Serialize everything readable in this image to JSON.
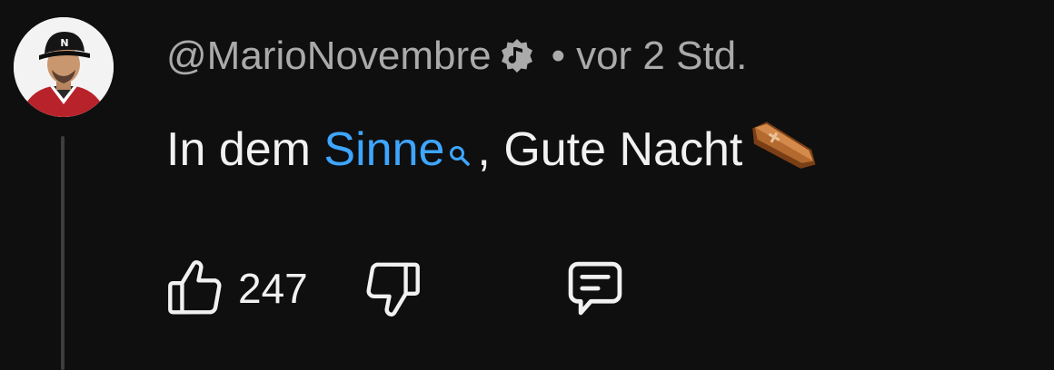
{
  "comment": {
    "author": "@MarioNovembre",
    "separator": "•",
    "time_ago": "vor 2 Std.",
    "text_before_link": "In dem ",
    "link_text": "Sinne",
    "text_after_link": ", Gute Nacht",
    "emoji": "coffin-emoji",
    "likes": "247"
  },
  "icons": {
    "author_badge": "music-note-badge-icon",
    "like": "thumbs-up-icon",
    "dislike": "thumbs-down-icon",
    "reply": "reply-icon",
    "link_search": "search-icon"
  },
  "colors": {
    "background": "#0f0f0f",
    "primary_text": "#f1f1f1",
    "secondary_text": "#aaaaaa",
    "link": "#3ea6ff"
  }
}
